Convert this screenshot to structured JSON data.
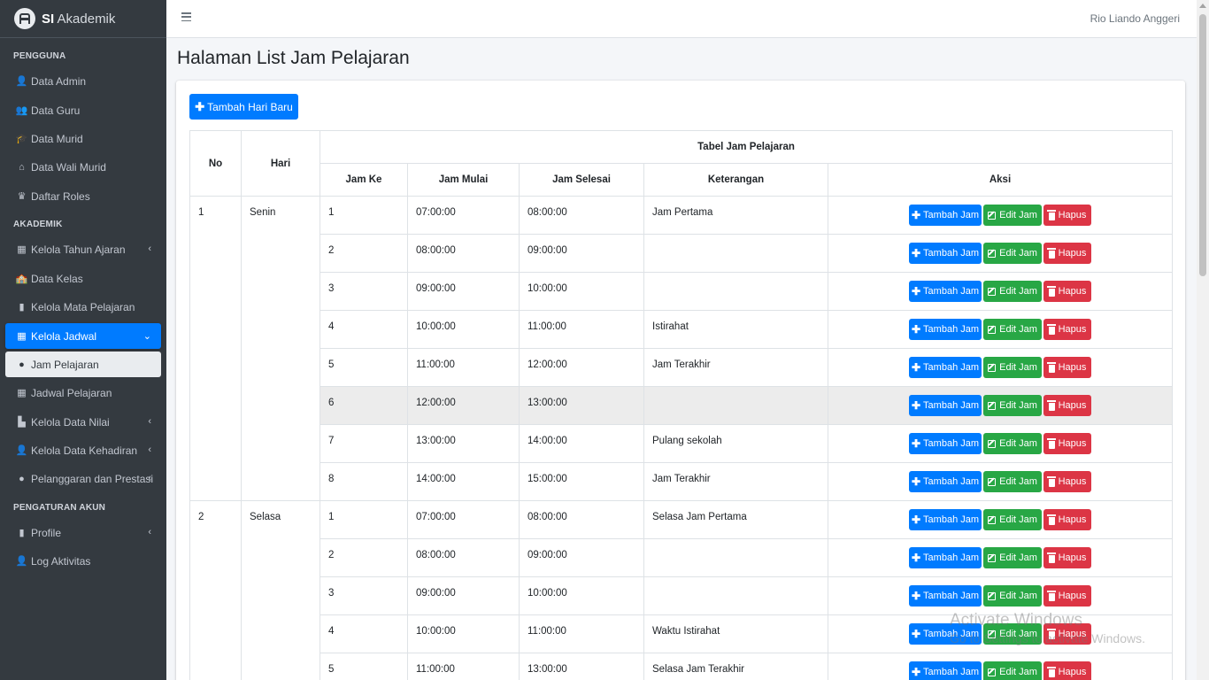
{
  "brand": {
    "bold": "SI",
    "light": "Akademik"
  },
  "topbar": {
    "user_name": "Rio Liando Anggeri"
  },
  "sidebar": {
    "headers": [
      "PENGGUNA",
      "AKADEMIK",
      "PENGATURAN AKUN"
    ],
    "items": [
      {
        "label": "Data Admin",
        "icon": "user-icon",
        "glyph": "👤"
      },
      {
        "label": "Data Guru",
        "icon": "users-icon",
        "glyph": "👥"
      },
      {
        "label": "Data Murid",
        "icon": "graduate-icon",
        "glyph": "🎓"
      },
      {
        "label": "Data Wali Murid",
        "icon": "home-icon",
        "glyph": "⌂"
      },
      {
        "label": "Daftar Roles",
        "icon": "crown-icon",
        "glyph": "♛"
      },
      {
        "label": "Kelola Tahun Ajaran",
        "icon": "calendar-icon",
        "glyph": "▦"
      },
      {
        "label": "Data Kelas",
        "icon": "school-icon",
        "glyph": "🏫"
      },
      {
        "label": "Kelola Mata Pelajaran",
        "icon": "book-icon",
        "glyph": "▮"
      },
      {
        "label": "Kelola Jadwal",
        "icon": "calendar-check-icon",
        "glyph": "▦"
      },
      {
        "label": "Jam Pelajaran",
        "icon": "clock-icon",
        "glyph": "●"
      },
      {
        "label": "Jadwal Pelajaran",
        "icon": "calendar-icon",
        "glyph": "▦"
      },
      {
        "label": "Kelola Data Nilai",
        "icon": "chart-icon",
        "glyph": "▙"
      },
      {
        "label": "Kelola Data Kehadiran",
        "icon": "user-check-icon",
        "glyph": "👤"
      },
      {
        "label": "Pelanggaran dan Prestasi",
        "icon": "alert-circle-icon",
        "glyph": "●"
      },
      {
        "label": "Profile",
        "icon": "id-card-icon",
        "glyph": "▮"
      },
      {
        "label": "Log Aktivitas",
        "icon": "user-cog-icon",
        "glyph": "👤"
      }
    ]
  },
  "page": {
    "title": "Halaman List Jam Pelajaran",
    "add_day_label": "Tambah Hari Baru"
  },
  "table": {
    "caption": "Tabel Jam Pelajaran",
    "headers": {
      "no": "No",
      "hari": "Hari",
      "jam_ke": "Jam Ke",
      "jam_mulai": "Jam Mulai",
      "jam_selesai": "Jam Selesai",
      "keterangan": "Keterangan",
      "aksi": "Aksi"
    },
    "actions": {
      "tambah": "Tambah Jam",
      "edit": "Edit Jam",
      "hapus": "Hapus"
    },
    "days": [
      {
        "no": "1",
        "hari": "Senin",
        "rows": [
          {
            "jam_ke": "1",
            "mulai": "07:00:00",
            "selesai": "08:00:00",
            "ket": "Jam Pertama"
          },
          {
            "jam_ke": "2",
            "mulai": "08:00:00",
            "selesai": "09:00:00",
            "ket": ""
          },
          {
            "jam_ke": "3",
            "mulai": "09:00:00",
            "selesai": "10:00:00",
            "ket": ""
          },
          {
            "jam_ke": "4",
            "mulai": "10:00:00",
            "selesai": "11:00:00",
            "ket": "Istirahat"
          },
          {
            "jam_ke": "5",
            "mulai": "11:00:00",
            "selesai": "12:00:00",
            "ket": "Jam Terakhir"
          },
          {
            "jam_ke": "6",
            "mulai": "12:00:00",
            "selesai": "13:00:00",
            "ket": ""
          },
          {
            "jam_ke": "7",
            "mulai": "13:00:00",
            "selesai": "14:00:00",
            "ket": "Pulang sekolah"
          },
          {
            "jam_ke": "8",
            "mulai": "14:00:00",
            "selesai": "15:00:00",
            "ket": "Jam Terakhir"
          }
        ]
      },
      {
        "no": "2",
        "hari": "Selasa",
        "rows": [
          {
            "jam_ke": "1",
            "mulai": "07:00:00",
            "selesai": "08:00:00",
            "ket": "Selasa Jam Pertama"
          },
          {
            "jam_ke": "2",
            "mulai": "08:00:00",
            "selesai": "09:00:00",
            "ket": ""
          },
          {
            "jam_ke": "3",
            "mulai": "09:00:00",
            "selesai": "10:00:00",
            "ket": ""
          },
          {
            "jam_ke": "4",
            "mulai": "10:00:00",
            "selesai": "11:00:00",
            "ket": "Waktu Istirahat"
          },
          {
            "jam_ke": "5",
            "mulai": "11:00:00",
            "selesai": "13:00:00",
            "ket": "Selasa Jam Terakhir"
          }
        ]
      }
    ]
  },
  "watermark": {
    "line1": "Activate Windows",
    "line2": "Go to Settings to activate Windows."
  },
  "colors": {
    "sidebar_bg": "#343a40",
    "primary": "#007bff",
    "success": "#28a745",
    "danger": "#dc3545"
  }
}
